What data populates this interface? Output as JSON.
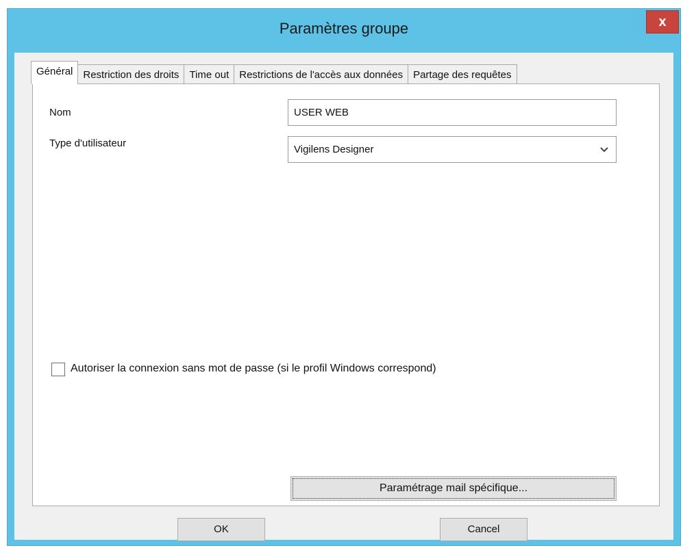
{
  "window": {
    "title": "Paramètres groupe",
    "close_label": "x"
  },
  "tabs": [
    {
      "label": "Général",
      "active": true
    },
    {
      "label": "Restriction des droits",
      "active": false
    },
    {
      "label": "Time out",
      "active": false
    },
    {
      "label": "Restrictions de l'accès aux données",
      "active": false
    },
    {
      "label": "Partage des requêtes",
      "active": false
    }
  ],
  "general": {
    "name_label": "Nom",
    "name_value": "USER WEB",
    "user_type_label": "Type d'utilisateur",
    "user_type_value": "Vigilens Designer",
    "passwordless_label": "Autoriser la connexion sans mot de passe (si le profil Windows correspond)",
    "passwordless_checked": false,
    "mail_settings_label": "Paramétrage mail spécifique..."
  },
  "footer": {
    "ok_label": "OK",
    "cancel_label": "Cancel"
  },
  "colors": {
    "title_bar": "#5ec2e6",
    "close_button": "#c8453d",
    "client_background": "#f0f0f0"
  },
  "icons": {
    "close": "close-icon",
    "dropdown": "chevron-down-icon"
  }
}
